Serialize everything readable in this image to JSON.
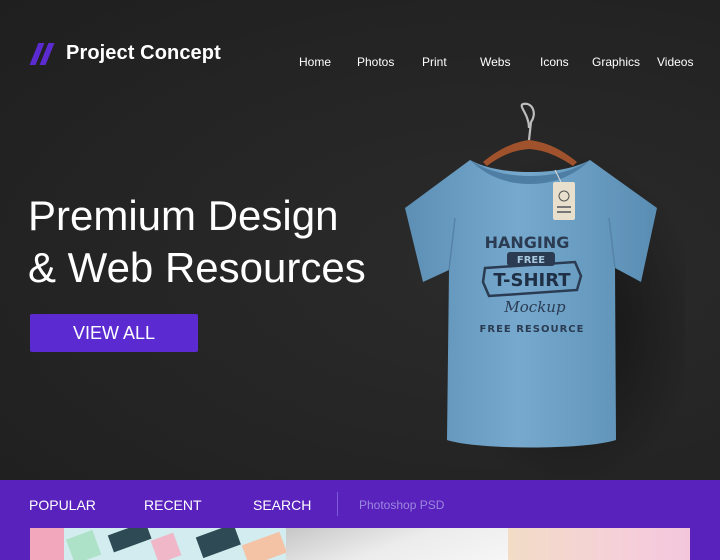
{
  "brand": {
    "name": "Project Concept"
  },
  "nav": {
    "items": [
      "Home",
      "Photos",
      "Print",
      "Webs",
      "Icons",
      "Graphics",
      "Videos"
    ]
  },
  "hero": {
    "headline_line1": "Premium Design",
    "headline_line2": "& Web Resources",
    "cta_label": "VIEW ALL",
    "tshirt_text": {
      "top": "HANGING",
      "free": "FREE",
      "banner": "T-SHIRT",
      "script": "Mockup",
      "bottom": "FREE RESOURCE"
    }
  },
  "filter_bar": {
    "popular": "POPULAR",
    "recent": "RECENT",
    "search": "SEARCH",
    "search_placeholder": "Photoshop PSD"
  },
  "colors": {
    "accent": "#5b2bd1",
    "bar": "#5a22bd",
    "background": "#262626",
    "shirt": "#6c9fc4"
  }
}
